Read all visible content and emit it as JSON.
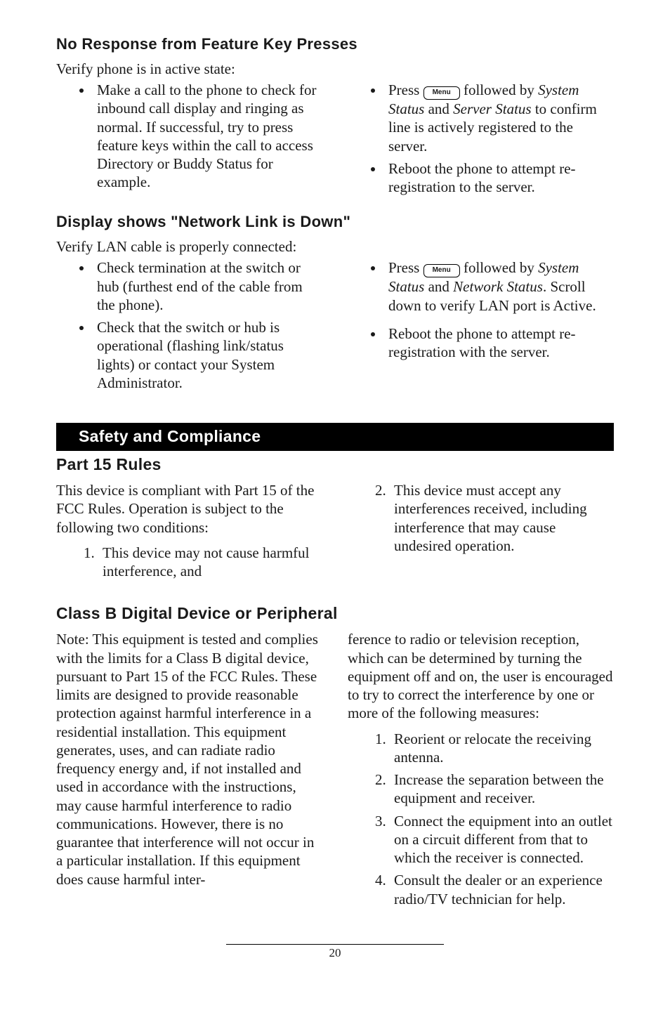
{
  "sections": {
    "noResponse": {
      "heading": "No Response from Feature Key Presses",
      "intro": "Verify phone is in active state:",
      "leftBullets": [
        "Make a call to the phone to check for inbound call display and ringing as normal.  If successful, try to press feature keys within the call to access Directory or Buddy Status for example."
      ],
      "rightBullet1_pre": "Press ",
      "menuLabel": "Menu",
      "rightBullet1_mid": " followed by ",
      "rightBullet1_italic1": "System Status",
      "rightBullet1_and": " and ",
      "rightBullet1_italic2": "Server Status",
      "rightBullet1_post": " to confirm line is actively registered to the server.",
      "rightBullet2": "Reboot the phone to attempt re-registration to the server."
    },
    "networkDown": {
      "heading": "Display shows \"Network Link is Down\"",
      "intro": "Verify LAN cable is properly connected:",
      "leftBullets": [
        "Check termination at the switch or hub (furthest end of the cable from the phone).",
        "Check that the switch or hub is operational (flashing link/status lights) or contact your System Administrator."
      ],
      "rightBullet1_pre": "Press ",
      "rightBullet1_mid": " followed by ",
      "rightBullet1_italic1": "System Status",
      "rightBullet1_and": " and ",
      "rightBullet1_italic2": "Network Status",
      "rightBullet1_post": ".  Scroll down to verify LAN port is Active.",
      "rightBullet2": "Reboot the phone to attempt re-registration with the server."
    },
    "safety": {
      "bar": "Safety and Compliance",
      "part15": {
        "heading": "Part 15 Rules",
        "intro": "This device is compliant with Part 15 of the FCC Rules.  Operation is subject to the following two conditions:",
        "item1": "This device may not cause harmful interference, and",
        "item2": "This device must accept any interferences received, including interference that may cause undesired operation."
      },
      "classB": {
        "heading": "Class B Digital Device or Peripheral",
        "leftBody": "Note:  This equipment is tested and complies with the limits for a Class B digital device, pursuant to Part 15 of the FCC Rules.  These limits are designed to provide reasonable protection against harmful interference in a residential installation.  This equipment generates, uses, and can radiate radio frequency energy and, if not installed and used in accordance with the instructions, may cause harmful interference to radio communications.  However, there is no guarantee that interference will not occur in a particular installation.  If this equipment does cause harmful inter-",
        "rightIntro": "ference to radio or television reception, which can be determined by turning the equipment off and on, the user is encouraged to try to correct the interference by one or more of the following measures:",
        "rightItems": [
          "Reorient or relocate the receiving antenna.",
          "Increase the separation between the equipment and receiver.",
          "Connect the equipment into an outlet on a circuit different from that to which the receiver is connected.",
          "Consult the dealer or an experience radio/TV technician for help."
        ]
      }
    },
    "pageNumber": "20"
  }
}
